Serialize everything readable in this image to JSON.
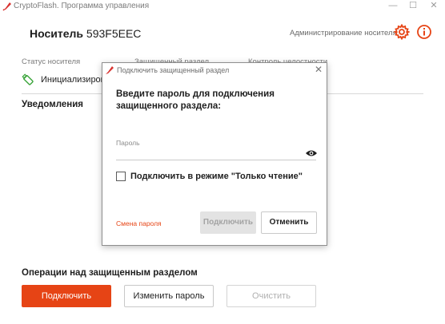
{
  "window": {
    "title": "CryptoFlash. Программа управления",
    "minimize": "—",
    "maximize": "☐",
    "close": "✕"
  },
  "header": {
    "device_label": "Носитель",
    "device_id": "593F5EEC",
    "admin_link": "Администрирование носителя"
  },
  "status": {
    "col1_label": "Статус носителя",
    "col2_label": "Защищенный раздел",
    "col3_label": "Контроль целостности",
    "value": "Инициализирова"
  },
  "notifications": {
    "title": "Уведомления"
  },
  "operations": {
    "title": "Операции над защищенным разделом",
    "connect": "Подключить",
    "change_password": "Изменить пароль",
    "clear": "Очистить"
  },
  "dialog": {
    "title": "Подключить защищенный раздел",
    "close": "✕",
    "prompt": "Введите пароль для подключения защищенного раздела:",
    "password_label": "Пароль",
    "password_value": "",
    "readonly_label": "Подключить в режиме \"Только чтение\"",
    "change_password_link": "Смена пароля",
    "connect_button": "Подключить",
    "cancel_button": "Отменить"
  },
  "colors": {
    "accent": "#e64415",
    "text": "#1e1e1e",
    "muted": "#7b7b7b"
  }
}
